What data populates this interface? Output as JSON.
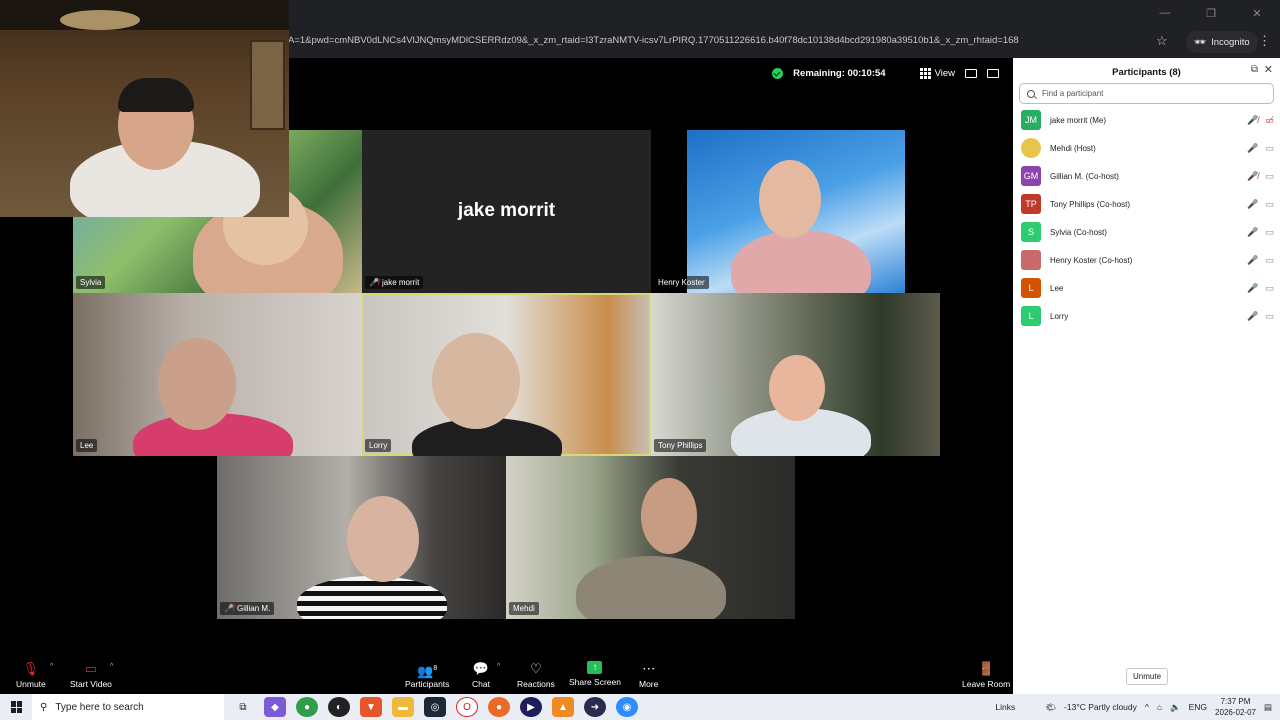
{
  "browser": {
    "url": "A=1&pwd=cmNBV0dLNCs4VlJNQmsyMDlCSERRdz09&_x_zm_rtaid=I3TzraNMTV-icsv7LrPIRQ.1770511226616.b40f78dc10138d4bcd291980a39510b1&_x_zm_rhtaid=168",
    "incognito_label": "Incognito"
  },
  "meeting": {
    "remaining": "Remaining: 00:10:54",
    "view_label": "View"
  },
  "tiles": [
    {
      "name": "Sylvia"
    },
    {
      "name": "jake morrit",
      "big_name": "jake morrit"
    },
    {
      "name": "Henry Koster"
    },
    {
      "name": "Lee"
    },
    {
      "name": "Lorry"
    },
    {
      "name": "Tony Phillips"
    },
    {
      "name": "Gillian M."
    },
    {
      "name": "Mehdi"
    }
  ],
  "toolbar": {
    "unmute": "Unmute",
    "start_video": "Start Video",
    "participants": "Participants",
    "participants_count": "8",
    "chat": "Chat",
    "reactions": "Reactions",
    "share_screen": "Share Screen",
    "more": "More",
    "leave_room": "Leave Room"
  },
  "panel": {
    "title": "Participants (8)",
    "search_placeholder": "Find a participant",
    "participants": [
      {
        "initials": "JM",
        "name": "jake morrit (Me)",
        "color": "#27ae60"
      },
      {
        "initials": "",
        "name": "Mehdi (Host)",
        "color": "#e6c64a"
      },
      {
        "initials": "GM",
        "name": "Gillian M. (Co-host)",
        "color": "#8e44ad"
      },
      {
        "initials": "TP",
        "name": "Tony Phillips (Co-host)",
        "color": "#c0392b"
      },
      {
        "initials": "S",
        "name": "Sylvia (Co-host)",
        "color": "#2ecc71"
      },
      {
        "initials": "",
        "name": "Henry Koster (Co-host)",
        "color": "#c86a6a"
      },
      {
        "initials": "L",
        "name": "Lee",
        "color": "#d35400"
      },
      {
        "initials": "L",
        "name": "Lorry",
        "color": "#2ecc71"
      }
    ],
    "unmute_button": "Unmute"
  },
  "taskbar": {
    "search_placeholder": "Type here to search",
    "links": "Links",
    "weather": "-13°C  Partly cloudy",
    "lang": "ENG",
    "time": "7:37 PM",
    "date": "2026-02-07"
  }
}
